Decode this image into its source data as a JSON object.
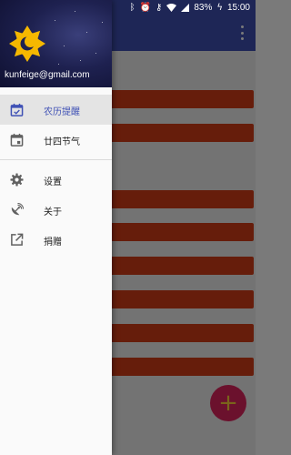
{
  "status_bar": {
    "battery": "83%",
    "time": "15:00",
    "icons": [
      "bluetooth-icon",
      "alarm-icon",
      "vpn-key-icon",
      "wifi-icon",
      "cellular-signal-icon",
      "battery-charging-icon"
    ]
  },
  "drawer": {
    "account_email": "kunfeige@gmail.com",
    "logo": "sun-moon-logo",
    "items": [
      {
        "label": "农历提醒",
        "icon": "calendar-check-icon",
        "active": true
      },
      {
        "label": "廿四节气",
        "icon": "calendar-event-icon",
        "active": false
      },
      {
        "label": "设置",
        "icon": "gear-icon",
        "active": false
      },
      {
        "label": "关于",
        "icon": "satellite-dish-icon",
        "active": false
      },
      {
        "label": "捐赠",
        "icon": "open-in-new-icon",
        "active": false
      }
    ]
  },
  "background": {
    "toolbar_color": "#3f51b5",
    "overflow_icon": "more-vert-icon",
    "reminder_bar_color": "#d63d17",
    "reminder_bar_count": 10,
    "fab": {
      "label": "+",
      "color": "#e0245e",
      "icon_color": "#ffd23a"
    }
  },
  "colors": {
    "accent": "#3f51b5",
    "drawer_header": "#1e2150"
  }
}
